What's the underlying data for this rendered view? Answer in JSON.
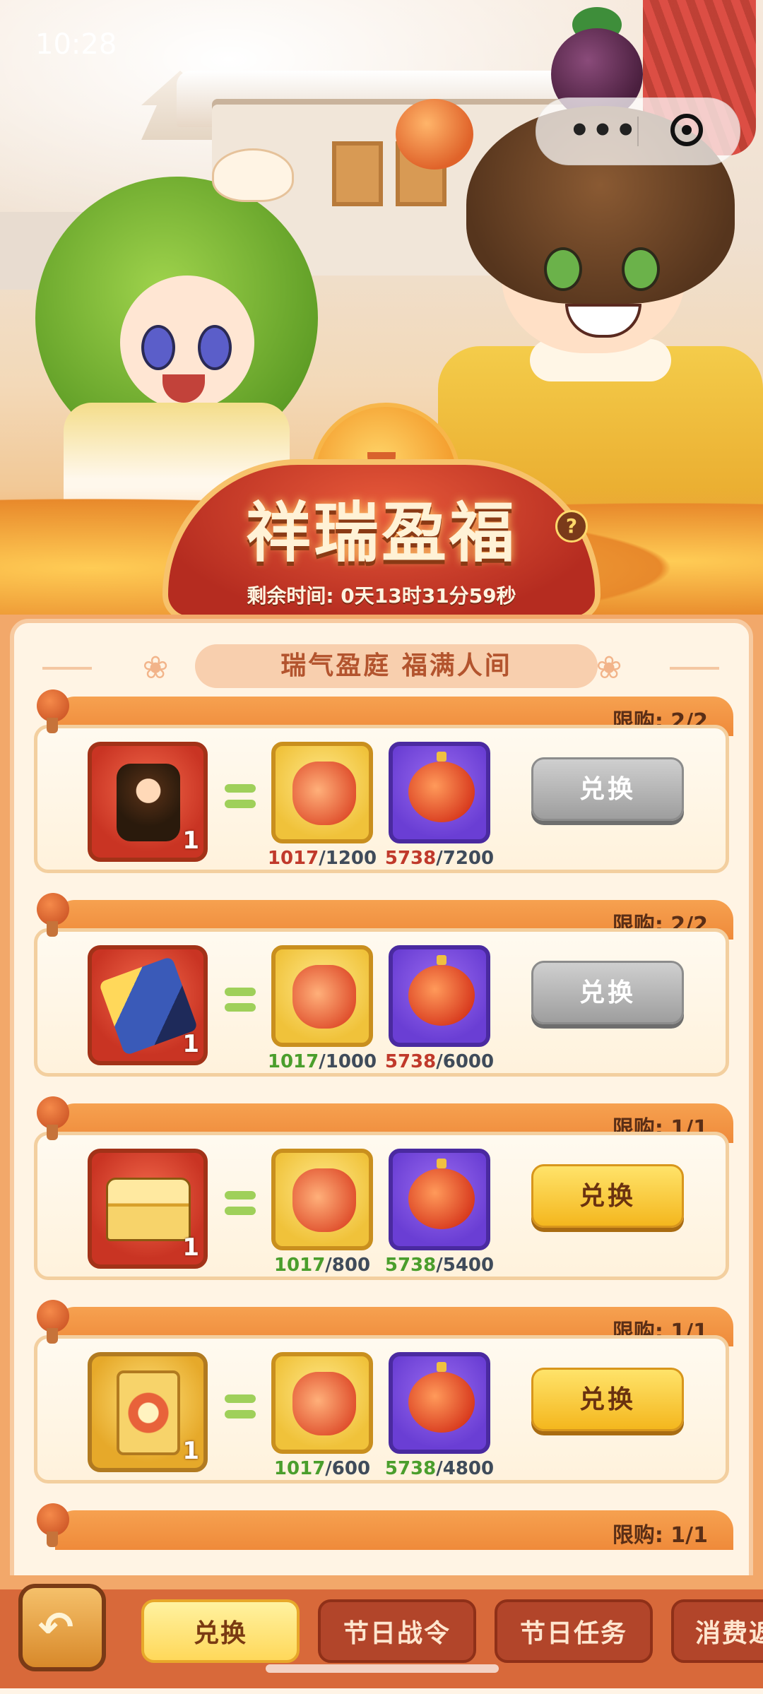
{
  "status": {
    "time": "10:28"
  },
  "capsule": {
    "more_icon": "more-dots-icon",
    "close_icon": "target-close-icon"
  },
  "event": {
    "title": "祥瑞盈福",
    "countdown": "剩余时间: 0天13时31分59秒",
    "subtitle": "瑞气盈庭 福满人间"
  },
  "exchange_items": [
    {
      "limit": "限购: 2/2",
      "reward_icon": "hero-character-icon",
      "reward_count": "1",
      "cost1_have": "1017",
      "cost1_need": "/1200",
      "cost1_status": "red",
      "cost2_have": "5738",
      "cost2_need": "/7200",
      "cost2_status": "red",
      "button": "兑换",
      "button_state": "disabled"
    },
    {
      "limit": "限购: 2/2",
      "reward_icon": "weapon-icon",
      "reward_count": "1",
      "cost1_have": "1017",
      "cost1_need": "/1000",
      "cost1_status": "green",
      "cost2_have": "5738",
      "cost2_need": "/6000",
      "cost2_status": "red",
      "button": "兑换",
      "button_state": "disabled"
    },
    {
      "limit": "限购: 1/1",
      "reward_icon": "treasure-chest-icon",
      "reward_count": "1",
      "cost1_have": "1017",
      "cost1_need": "/800",
      "cost1_status": "green",
      "cost2_have": "5738",
      "cost2_need": "/5400",
      "cost2_status": "green",
      "button": "兑换",
      "button_state": "active"
    },
    {
      "limit": "限购: 1/1",
      "reward_icon": "card-frame-icon",
      "reward_count": "1",
      "cost1_have": "1017",
      "cost1_need": "/600",
      "cost1_status": "green",
      "cost2_have": "5738",
      "cost2_need": "/4800",
      "cost2_status": "green",
      "button": "兑换",
      "button_state": "active"
    },
    {
      "limit": "限购: 1/1"
    }
  ],
  "cost_icons": {
    "cost1": "lucky-bag-icon",
    "cost2": "red-lantern-icon"
  },
  "tabs": [
    {
      "label": "兑换",
      "active": true
    },
    {
      "label": "节日战令",
      "active": false
    },
    {
      "label": "节日任务",
      "active": false
    },
    {
      "label": "消费返",
      "active": false
    }
  ]
}
